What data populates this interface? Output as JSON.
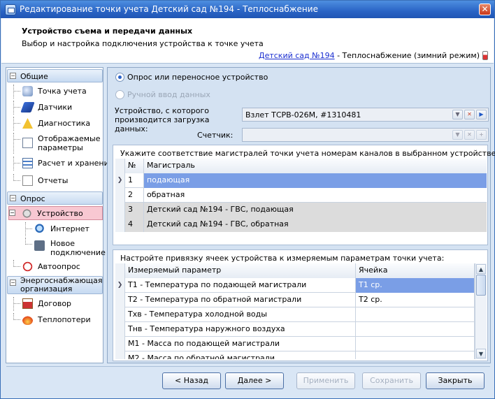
{
  "window": {
    "title": "Редактирование точки учета Детский сад №194 - Теплоснабжение",
    "close_label": "✕"
  },
  "header": {
    "title": "Устройство съема и передачи данных",
    "subtitle": "Выбор и настройка подключения устройства к точке учета",
    "link": "Детский сад №194",
    "link_suffix": " - Теплоснабжение (зимний режим)"
  },
  "nav": {
    "groups": [
      {
        "label": "Общие",
        "toggle": "−"
      },
      {
        "label": "Опрос",
        "toggle": "−"
      },
      {
        "label": "Энергоснабжающая организация",
        "toggle": "−"
      }
    ],
    "items": [
      {
        "label": "Точка учета",
        "icon": "meter-icon"
      },
      {
        "label": "Датчики",
        "icon": "pen-sensor-icon"
      },
      {
        "label": "Диагностика",
        "icon": "warning-icon"
      },
      {
        "label": "Отображаемые параметры",
        "icon": "checklist-icon"
      },
      {
        "label": "Расчет и хранение",
        "icon": "calculator-icon"
      },
      {
        "label": "Отчеты",
        "icon": "document-icon"
      },
      {
        "label": "Устройство",
        "icon": "device-icon"
      },
      {
        "label": "Интернет",
        "icon": "globe-icon"
      },
      {
        "label": "Новое подключение",
        "icon": "connection-icon"
      },
      {
        "label": "Автоопрос",
        "icon": "alarm-clock-icon"
      },
      {
        "label": "Договор",
        "icon": "contract-icon"
      },
      {
        "label": "Теплопотери",
        "icon": "flame-icon"
      }
    ]
  },
  "main": {
    "radio_poll": "Опрос или переносное устройство",
    "radio_manual": "Ручной ввод данных",
    "device_label": "Устройство, с которого производится загрузка данных:",
    "device_value": "Взлет ТСРВ-026М, #1310481",
    "counter_label": "Счетчик:",
    "counter_value": "",
    "mapping_title": "Укажите соответствие магистралей точки учета номерам каналов в выбранном устройстве:",
    "mapping_columns": [
      "№",
      "Магистраль"
    ],
    "mapping_rows": [
      {
        "n": "1",
        "name": "подающая"
      },
      {
        "n": "2",
        "name": "обратная"
      },
      {
        "n": "3",
        "name": "Детский сад №194 - ГВС, подающая"
      },
      {
        "n": "4",
        "name": "Детский сад №194 - ГВС, обратная"
      }
    ],
    "cells_title": "Настройте привязку ячеек устройства к измеряемым параметрам точки учета:",
    "cells_columns": [
      "Измеряемый параметр",
      "Ячейка"
    ],
    "cells_rows": [
      {
        "param": "T1 - Температура по подающей магистрали",
        "cell": "T1 ср."
      },
      {
        "param": "T2 - Температура по обратной магистрали",
        "cell": "T2 ср."
      },
      {
        "param": "Тхв - Температура холодной воды",
        "cell": ""
      },
      {
        "param": "Тнв - Температура наружного воздуха",
        "cell": ""
      },
      {
        "param": "M1 - Масса по подающей магистрали",
        "cell": ""
      },
      {
        "param": "M2 - Масса по обратной магистрали",
        "cell": ""
      }
    ]
  },
  "footer": {
    "back": "< Назад",
    "next": "Далее >",
    "apply": "Применить",
    "save": "Сохранить",
    "close": "Закрыть"
  }
}
